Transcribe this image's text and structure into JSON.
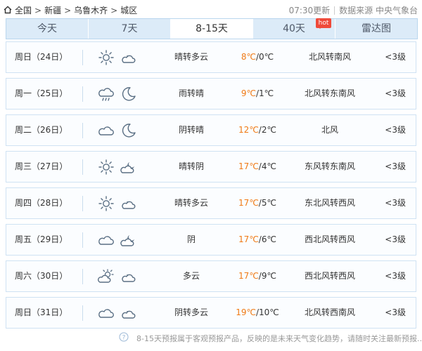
{
  "breadcrumb": [
    "全国",
    "新疆",
    "乌鲁木齐",
    "城区"
  ],
  "source": {
    "update": "07:30更新",
    "provider": "数据来源 中央气象台"
  },
  "tabs": [
    {
      "label": "今天"
    },
    {
      "label": "7天"
    },
    {
      "label": "8-15天",
      "active": true
    },
    {
      "label": "40天",
      "badge": "hot"
    },
    {
      "label": "雷达图"
    }
  ],
  "forecast": [
    {
      "day": "周日（24日）",
      "icon_day": "sunny-icon",
      "icon_night": "cloudy-night-icon",
      "desc": "晴转多云",
      "high": "8℃",
      "low": "/0℃",
      "wind": "北风转南风",
      "level": "<3级"
    },
    {
      "day": "周一（25日）",
      "icon_day": "rain-icon",
      "icon_night": "moon-icon",
      "desc": "雨转晴",
      "high": "9℃",
      "low": "/1℃",
      "wind": "北风转东南风",
      "level": "<3级"
    },
    {
      "day": "周二（26日）",
      "icon_day": "overcast-icon",
      "icon_night": "moon-icon",
      "desc": "阴转晴",
      "high": "12℃",
      "low": "/2℃",
      "wind": "北风",
      "level": "<3级"
    },
    {
      "day": "周三（27日）",
      "icon_day": "sunny-icon",
      "icon_night": "partly-cloudy-night-icon",
      "desc": "晴转阴",
      "high": "17℃",
      "low": "/4℃",
      "wind": "东风转东南风",
      "level": "<3级"
    },
    {
      "day": "周四（28日）",
      "icon_day": "sunny-icon",
      "icon_night": "cloudy-night-icon",
      "desc": "晴转多云",
      "high": "17℃",
      "low": "/5℃",
      "wind": "东北风转西风",
      "level": "<3级"
    },
    {
      "day": "周五（29日）",
      "icon_day": "overcast-icon",
      "icon_night": "partly-cloudy-night-icon",
      "desc": "阴",
      "high": "17℃",
      "low": "/6℃",
      "wind": "西北风转西风",
      "level": "<3级"
    },
    {
      "day": "周六（30日）",
      "icon_day": "partly-cloudy-day-icon",
      "icon_night": "cloudy-night-icon",
      "desc": "多云",
      "high": "17℃",
      "low": "/9℃",
      "wind": "西北风转西风",
      "level": "<3级"
    },
    {
      "day": "周日（31日）",
      "icon_day": "overcast-icon",
      "icon_night": "cloudy-night-icon",
      "desc": "阴转多云",
      "high": "19℃",
      "low": "/10℃",
      "wind": "北风转西南风",
      "level": "<3级"
    }
  ],
  "footer": "8-15天预报属于客观预报产品，反映的是未来天气变化趋势，请随时关注最新预报...",
  "colors": {
    "accent": "#f07a15",
    "tab_bg": "#dcebf8",
    "border": "#cfe2f3",
    "hot": "#ef4a3a"
  }
}
